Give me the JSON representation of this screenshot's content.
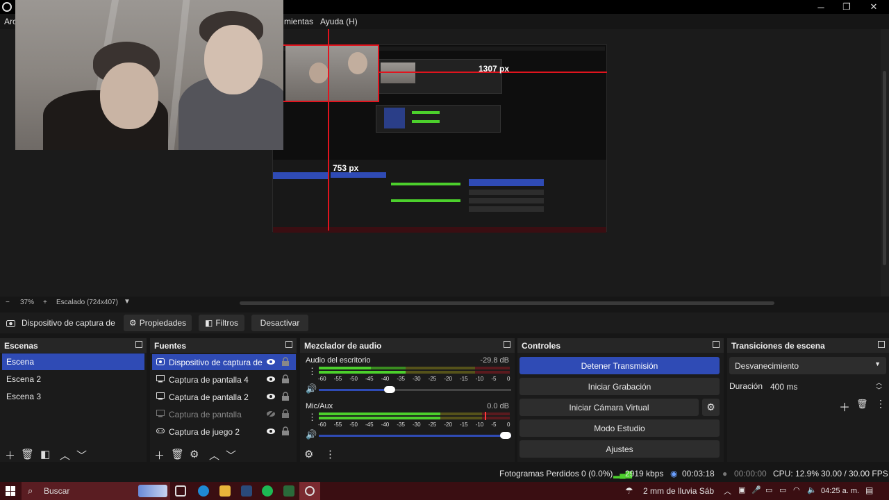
{
  "window": {
    "minimize": "─",
    "restore": "❐",
    "close": "✕"
  },
  "menu": {
    "file_partial": "Arc",
    "tools_partial": "mientas",
    "help": "Ayuda (H)"
  },
  "preview": {
    "guide_h": "1307 px",
    "guide_v": "753 px"
  },
  "zoom": {
    "minus": "−",
    "percent": "37%",
    "plus": "+",
    "scaling": "Escalado (724x407)"
  },
  "source_toolbar": {
    "source_name": "Dispositivo de captura de v",
    "properties": "Propiedades",
    "filters": "Filtros",
    "deactivate": "Desactivar"
  },
  "scenes": {
    "title": "Escenas",
    "items": [
      "Escena",
      "Escena 2",
      "Escena 3"
    ],
    "selected": 0
  },
  "sources": {
    "title": "Fuentes",
    "items": [
      {
        "label": "Dispositivo de captura de v",
        "icon": "camera-icon",
        "visible": true
      },
      {
        "label": "Captura de pantalla 4",
        "icon": "monitor-icon",
        "visible": true
      },
      {
        "label": "Captura de pantalla 2",
        "icon": "monitor-icon",
        "visible": true
      },
      {
        "label": "Captura de pantalla",
        "icon": "monitor-icon",
        "visible": false
      },
      {
        "label": "Captura de juego 2",
        "icon": "gamepad-icon",
        "visible": true
      }
    ]
  },
  "mixer": {
    "title": "Mezclador de audio",
    "ticks": [
      "-60",
      "-55",
      "-50",
      "-45",
      "-40",
      "-35",
      "-30",
      "-25",
      "-20",
      "-15",
      "-10",
      "-5",
      "0"
    ],
    "channels": [
      {
        "name": "Audio del escritorio",
        "db": "-29.8 dB",
        "volume": 0.37
      },
      {
        "name": "Mic/Aux",
        "db": "0.0 dB",
        "volume": 1.0
      }
    ]
  },
  "controls": {
    "title": "Controles",
    "stream": "Detener Transmisión",
    "record": "Iniciar Grabación",
    "virtualcam": "Iniciar Cámara Virtual",
    "studio": "Modo Estudio",
    "settings": "Ajustes"
  },
  "transitions": {
    "title": "Transiciones de escena",
    "selected": "Desvanecimiento",
    "duration_label": "Duración",
    "duration_value": "400 ms"
  },
  "status": {
    "dropped": "Fotogramas Perdidos 0 (0.0%)",
    "kbps": "2919 kbps",
    "live_time": "00:03:18",
    "rec_time": "00:00:00",
    "cpu": "CPU: 12.9%",
    "fps": "30.00 / 30.00 FPS"
  },
  "taskbar": {
    "search": "Buscar",
    "weather": "2 mm de lluvia Sáb",
    "time": "04:25 a. m."
  },
  "colors": {
    "accent": "#2f4bb5",
    "guide": "#e0141e",
    "meter_green": "#4cd02c",
    "taskbar": "#3a0e12"
  }
}
